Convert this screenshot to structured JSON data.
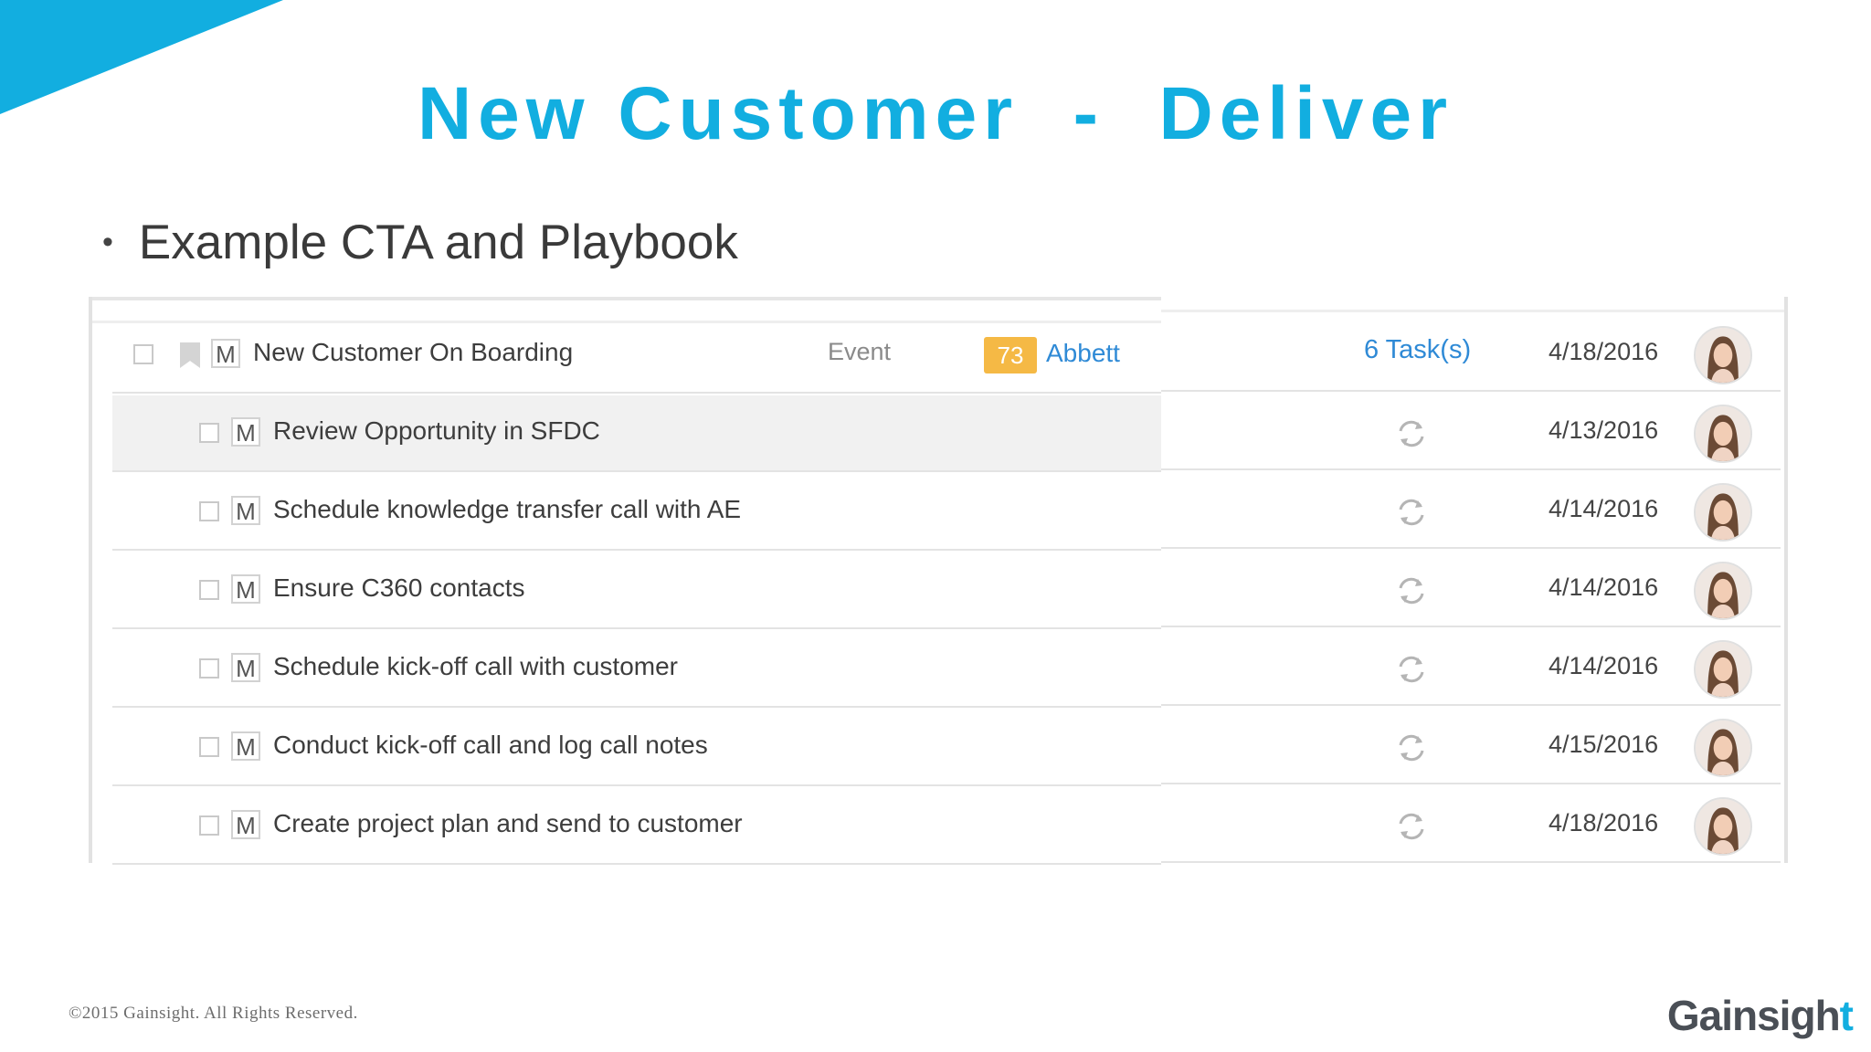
{
  "slide": {
    "title": "New Customer  -  Deliver",
    "bullet": "Example CTA and Playbook"
  },
  "cta": {
    "type_badge": "M",
    "name": "New Customer On Boarding",
    "reason": "Event",
    "score": "73",
    "account": "Abbett",
    "tasks": "6 Task(s)",
    "date": "4/18/2016"
  },
  "tasks": [
    {
      "type_badge": "M",
      "name": "Review Opportunity in SFDC",
      "date": "4/13/2016"
    },
    {
      "type_badge": "M",
      "name": "Schedule knowledge transfer call with AE",
      "date": "4/14/2016"
    },
    {
      "type_badge": "M",
      "name": "Ensure C360 contacts",
      "date": "4/14/2016"
    },
    {
      "type_badge": "M",
      "name": "Schedule kick-off call with customer",
      "date": "4/14/2016"
    },
    {
      "type_badge": "M",
      "name": "Conduct kick-off call and log call notes",
      "date": "4/15/2016"
    },
    {
      "type_badge": "M",
      "name": "Create project plan and send to customer",
      "date": "4/18/2016"
    }
  ],
  "footer": {
    "copyright": "©2015 Gainsight. All Rights Reserved.",
    "logo_main": "Gainsigh",
    "logo_accent": "t"
  },
  "colors": {
    "accent": "#12aee0",
    "link": "#2f8ad6",
    "score_badge": "#f5b945"
  },
  "icons": [
    "bookmark-icon",
    "refresh-icon",
    "avatar"
  ]
}
